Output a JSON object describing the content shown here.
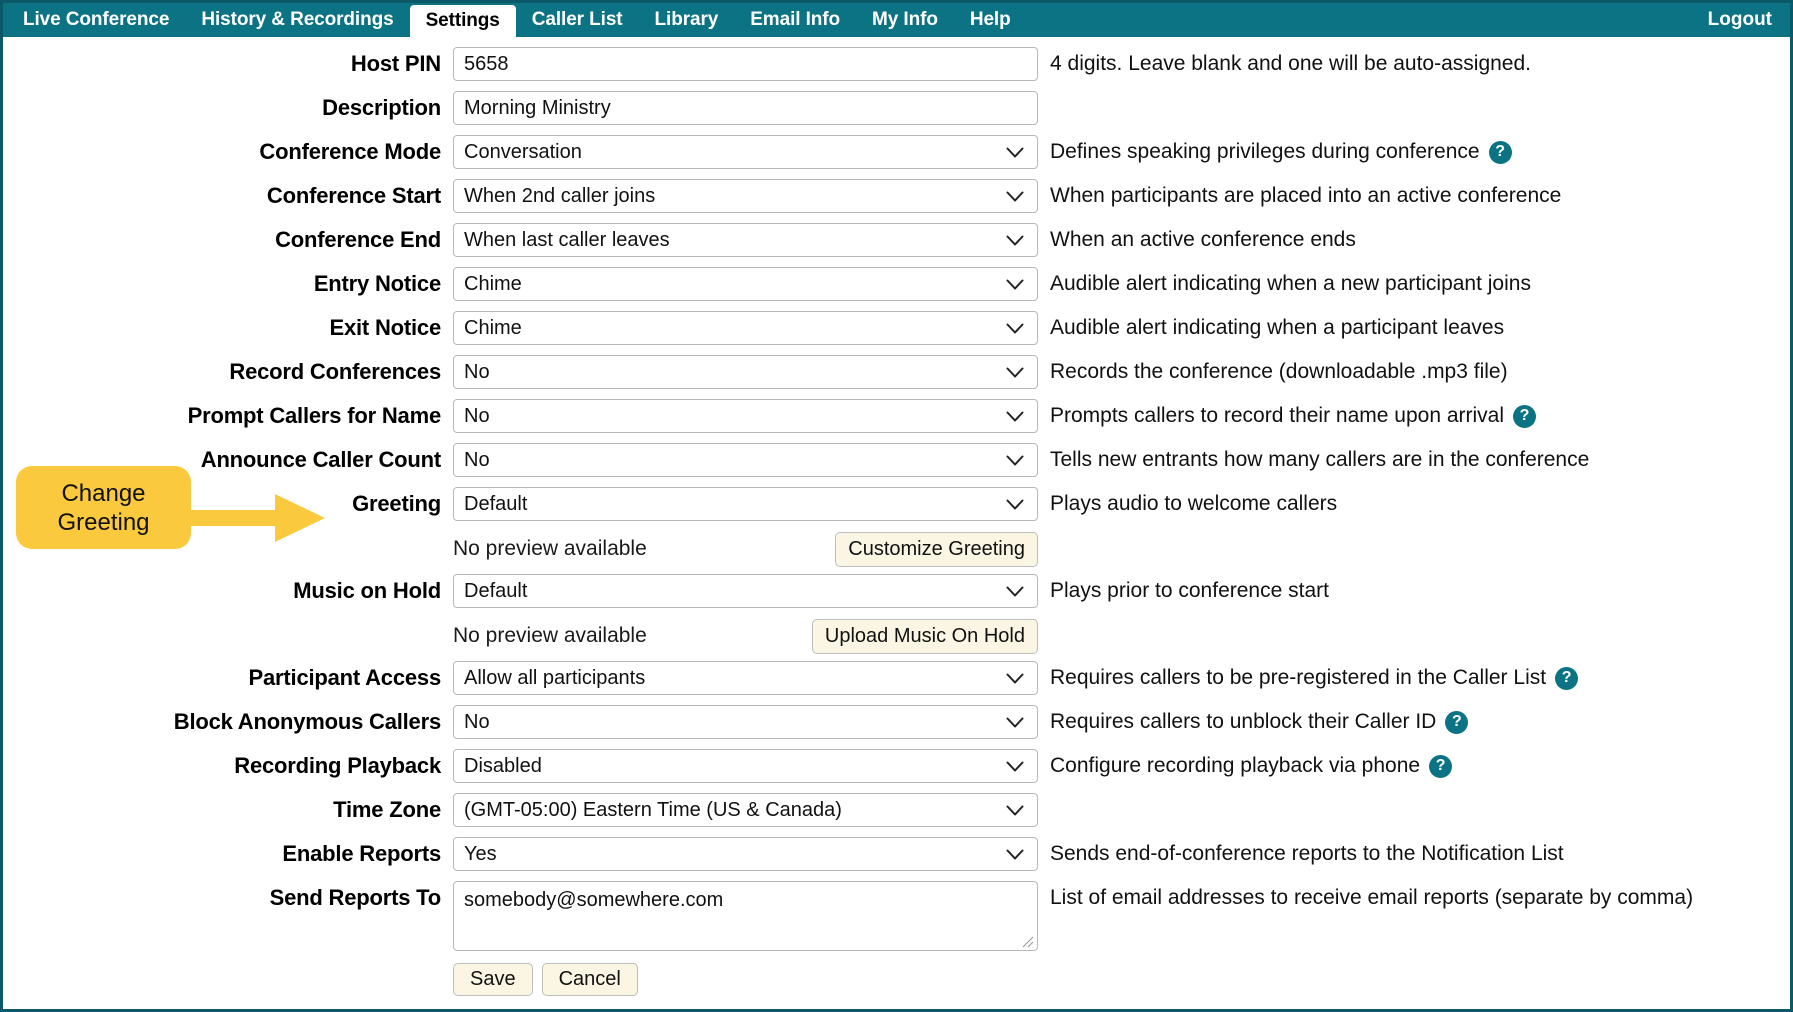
{
  "nav": {
    "items": [
      {
        "label": "Live Conference",
        "active": false
      },
      {
        "label": "History & Recordings",
        "active": false
      },
      {
        "label": "Settings",
        "active": true
      },
      {
        "label": "Caller List",
        "active": false
      },
      {
        "label": "Library",
        "active": false
      },
      {
        "label": "Email Info",
        "active": false
      },
      {
        "label": "My Info",
        "active": false
      },
      {
        "label": "Help",
        "active": false
      }
    ],
    "logout_label": "Logout"
  },
  "colors": {
    "nav_bg": "#0b7383",
    "page_border": "#0b5868",
    "help_icon_bg": "#0b7383",
    "callout_bg": "#fbc93d",
    "button_bg": "#fbf6e4"
  },
  "form": {
    "rows": [
      {
        "label": "Host PIN",
        "type": "text",
        "value": "5658",
        "help": "4 digits. Leave blank and one will be auto-assigned.",
        "help_icon": false
      },
      {
        "label": "Description",
        "type": "text",
        "value": "Morning Ministry",
        "help": "",
        "help_icon": false
      },
      {
        "label": "Conference Mode",
        "type": "select",
        "value": "Conversation",
        "help": "Defines speaking privileges during conference",
        "help_icon": true
      },
      {
        "label": "Conference Start",
        "type": "select",
        "value": "When 2nd caller joins",
        "help": "When participants are placed into an active conference",
        "help_icon": false
      },
      {
        "label": "Conference End",
        "type": "select",
        "value": "When last caller leaves",
        "help": "When an active conference ends",
        "help_icon": false
      },
      {
        "label": "Entry Notice",
        "type": "select",
        "value": "Chime",
        "help": "Audible alert indicating when a new participant joins",
        "help_icon": false
      },
      {
        "label": "Exit Notice",
        "type": "select",
        "value": "Chime",
        "help": "Audible alert indicating when a participant leaves",
        "help_icon": false
      },
      {
        "label": "Record Conferences",
        "type": "select",
        "value": "No",
        "help": "Records the conference (downloadable .mp3 file)",
        "help_icon": false
      },
      {
        "label": "Prompt Callers for Name",
        "type": "select",
        "value": "No",
        "help": "Prompts callers to record their name upon arrival",
        "help_icon": true
      },
      {
        "label": "Announce Caller Count",
        "type": "select",
        "value": "No",
        "help": "Tells new entrants how many callers are in the conference",
        "help_icon": false
      },
      {
        "label": "Greeting",
        "type": "select",
        "value": "Default",
        "help": "Plays audio to welcome callers",
        "help_icon": false
      },
      {
        "label": "",
        "type": "subrow",
        "preview": "No preview available",
        "button": "Customize Greeting",
        "help": "",
        "help_icon": false
      },
      {
        "label": "Music on Hold",
        "type": "select",
        "value": "Default",
        "help": "Plays prior to conference start",
        "help_icon": false
      },
      {
        "label": "",
        "type": "subrow",
        "preview": "No preview available",
        "button": "Upload Music On Hold",
        "help": "",
        "help_icon": false
      },
      {
        "label": "Participant Access",
        "type": "select",
        "value": "Allow all participants",
        "help": "Requires callers to be pre-registered in the Caller List",
        "help_icon": true
      },
      {
        "label": "Block Anonymous Callers",
        "type": "select",
        "value": "No",
        "help": "Requires callers to unblock their Caller ID",
        "help_icon": true
      },
      {
        "label": "Recording Playback",
        "type": "select",
        "value": "Disabled",
        "help": "Configure recording playback via phone",
        "help_icon": true
      },
      {
        "label": "Time Zone",
        "type": "select",
        "value": "(GMT-05:00) Eastern Time (US & Canada)",
        "help": "",
        "help_icon": false
      },
      {
        "label": "Enable Reports",
        "type": "select",
        "value": "Yes",
        "help": "Sends end-of-conference reports to the Notification List",
        "help_icon": false
      },
      {
        "label": "Send Reports To",
        "type": "textarea",
        "value": "somebody@somewhere.com",
        "help": "List of email addresses to receive email reports (separate by comma)",
        "help_icon": false
      }
    ],
    "save_label": "Save",
    "cancel_label": "Cancel"
  },
  "annotation": {
    "callout_text_line1": "Change",
    "callout_text_line2": "Greeting"
  }
}
